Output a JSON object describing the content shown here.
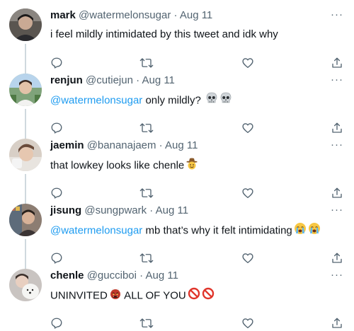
{
  "colors": {
    "text": "#0f1419",
    "secondary": "#536471",
    "mention": "#1d9bf0",
    "thread_line": "#cfd9de"
  },
  "more_label": "···",
  "tweets": [
    {
      "name": "mark",
      "handle": "@watermelonsugar",
      "sep": "·",
      "date": "Aug 11",
      "text": "i feel mildly intimidated by this tweet and idk why",
      "emojis": []
    },
    {
      "name": "renjun",
      "handle": "@cutiejun",
      "sep": "·",
      "date": "Aug 11",
      "mention": "@watermelonsugar",
      "text": " only mildly?",
      "emojis": [
        "skull-emoji",
        "skull-emoji"
      ]
    },
    {
      "name": "jaemin",
      "handle": "@bananajaem",
      "sep": "·",
      "date": "Aug 11",
      "text": "that lowkey looks like chenle",
      "emojis": [
        "cowboy-emoji"
      ]
    },
    {
      "name": "jisung",
      "handle": "@sungpwark",
      "sep": "·",
      "date": "Aug 11",
      "mention": "@watermelonsugar",
      "text": " mb that’s why it felt intimidating",
      "emojis": [
        "sob-emoji",
        "sob-emoji"
      ]
    },
    {
      "name": "chenle",
      "handle": "@gucciboi",
      "sep": "·",
      "date": "Aug 11",
      "text": "UNINVITED",
      "text2": " ALL OF YOU",
      "emojis": [
        "ogre-emoji",
        "prohibited-emoji",
        "prohibited-emoji"
      ]
    }
  ]
}
